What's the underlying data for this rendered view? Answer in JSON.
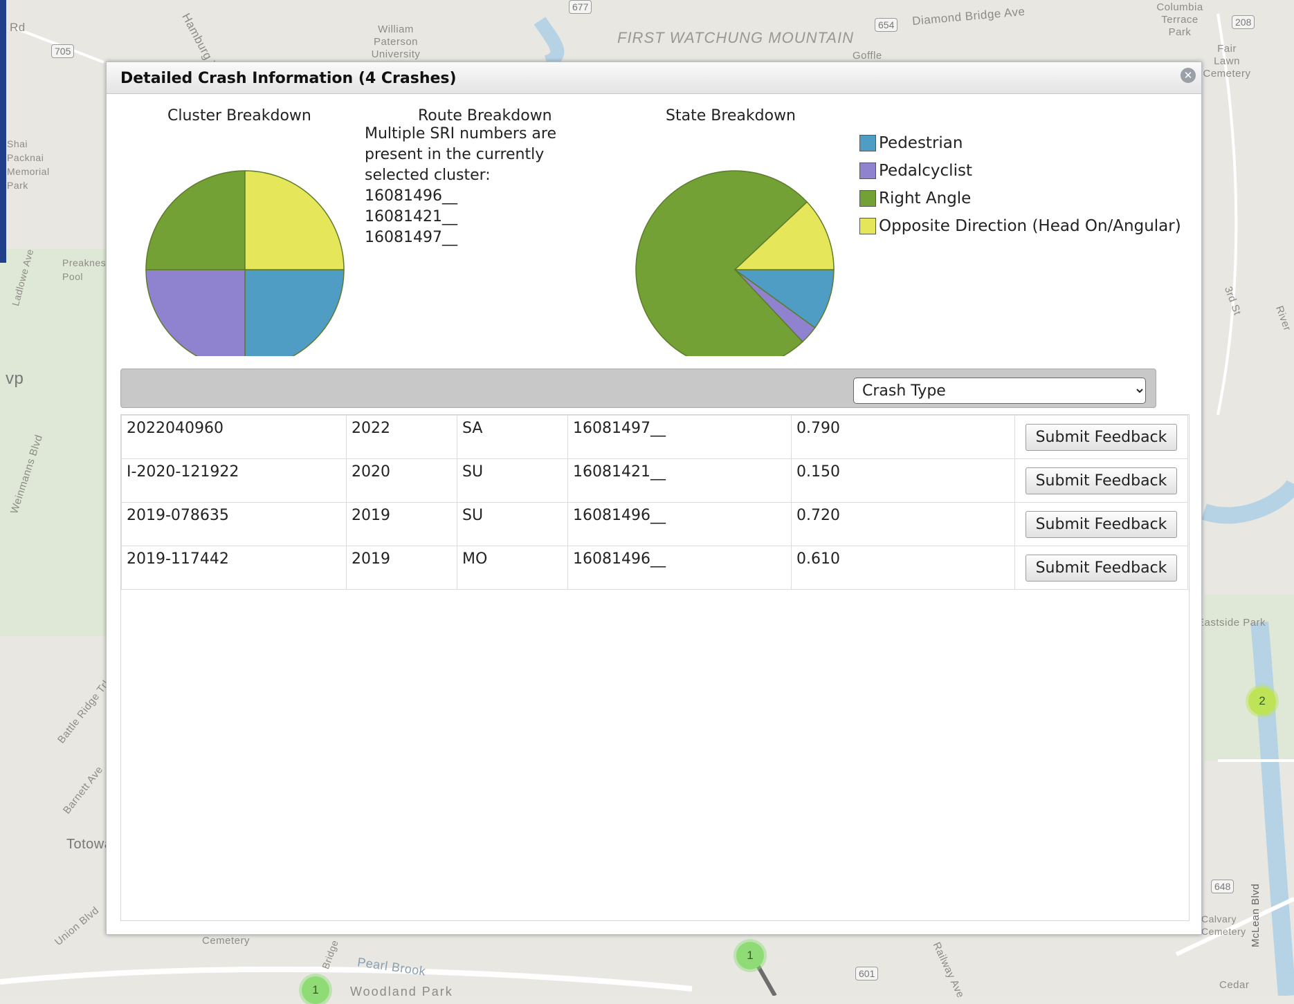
{
  "map": {
    "labels": [
      "Rd",
      "Hamburg Tpke",
      "William Paterson University",
      "FIRST WATCHUNG MOUNTAIN",
      "Diamond Bridge Ave",
      "Goffle",
      "Columbia Terrace Park",
      "Fair Lawn Cemetery",
      "Shai Packnai Memorial Park",
      "Ladlowe Ave",
      "Preakness Pool",
      "vp",
      "Weinmanns Blvd",
      "Battle Ridge Trl",
      "Barnett Ave",
      "Totowa",
      "Union Blvd",
      "Cemetery",
      "Pearl Brook",
      "Woodland Park",
      "Bridge",
      "3rd St",
      "River",
      "Eastside Park",
      "Calvary Cemetery",
      "McLean Blvd",
      "Cedar",
      "Railway Ave"
    ],
    "route_shields": [
      "705",
      "677",
      "654",
      "208",
      "648",
      "601"
    ],
    "markers": [
      "2",
      "1",
      "1"
    ]
  },
  "dialog": {
    "title": "Detailed Crash Information (4 Crashes)",
    "close_icon": "close-icon"
  },
  "cluster_breakdown": {
    "title": "Cluster Breakdown"
  },
  "route_breakdown": {
    "title": "Route Breakdown",
    "lines": [
      "Multiple SRI numbers are",
      "present in the currently",
      "selected cluster:",
      "16081496__",
      "16081421__",
      "16081497__"
    ]
  },
  "state_breakdown": {
    "title": "State Breakdown"
  },
  "legend": [
    {
      "label": "Pedestrian",
      "color": "#4f9dc4"
    },
    {
      "label": "Pedalcyclist",
      "color": "#8f83d0"
    },
    {
      "label": "Right Angle",
      "color": "#73a136"
    },
    {
      "label": "Opposite Direction (Head On/Angular)",
      "color": "#e6e65a"
    }
  ],
  "chart_data": [
    {
      "type": "pie",
      "title": "Cluster Breakdown",
      "labels": [
        "Pedestrian",
        "Pedalcyclist",
        "Right Angle",
        "Opposite Direction (Head On/Angular)"
      ],
      "values": [
        1,
        1,
        1,
        1
      ]
    },
    {
      "type": "pie",
      "title": "State Breakdown",
      "labels": [
        "Pedestrian",
        "Pedalcyclist",
        "Right Angle",
        "Opposite Direction (Head On/Angular)"
      ],
      "values": [
        10,
        3,
        75,
        12
      ]
    }
  ],
  "grid": {
    "dropdown_selected": "Crash Type",
    "button_label": "Submit Feedback",
    "rows": [
      [
        "2022040960",
        "2022",
        "SA",
        "16081497__",
        "0.790"
      ],
      [
        "I-2020-121922",
        "2020",
        "SU",
        "16081421__",
        "0.150"
      ],
      [
        "2019-078635",
        "2019",
        "SU",
        "16081496__",
        "0.720"
      ],
      [
        "2019-117442",
        "2019",
        "MO",
        "16081496__",
        "0.610"
      ]
    ]
  }
}
